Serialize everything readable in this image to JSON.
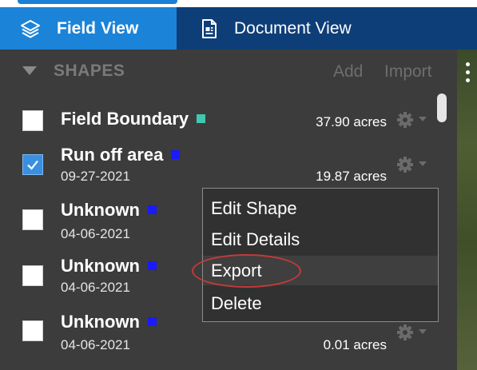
{
  "tabs": [
    {
      "label": "Field View",
      "icon": "layers-icon",
      "active": true
    },
    {
      "label": "Document View",
      "icon": "document-icon",
      "active": false
    }
  ],
  "section": {
    "title": "SHAPES",
    "add_label": "Add",
    "import_label": "Import"
  },
  "shapes": [
    {
      "name": "Field Boundary",
      "color": "#3ec9b0",
      "date": "",
      "acres": "37.90 acres",
      "checked": false
    },
    {
      "name": "Run off area",
      "color": "#1a1aff",
      "date": "09-27-2021",
      "acres": "19.87 acres",
      "checked": true
    },
    {
      "name": "Unknown",
      "color": "#1a1aff",
      "date": "04-06-2021",
      "acres": "",
      "checked": false
    },
    {
      "name": "Unknown",
      "color": "#1a1aff",
      "date": "04-06-2021",
      "acres": "",
      "checked": false
    },
    {
      "name": "Unknown",
      "color": "#1a1aff",
      "date": "04-06-2021",
      "acres": "0.01 acres",
      "checked": false
    }
  ],
  "context_menu": {
    "items": [
      {
        "label": "Edit Shape",
        "highlighted": false
      },
      {
        "label": "Edit Details",
        "highlighted": false
      },
      {
        "label": "Export",
        "highlighted": true
      },
      {
        "label": "Delete",
        "highlighted": false
      }
    ],
    "annotation_color": "#c33a3a"
  }
}
